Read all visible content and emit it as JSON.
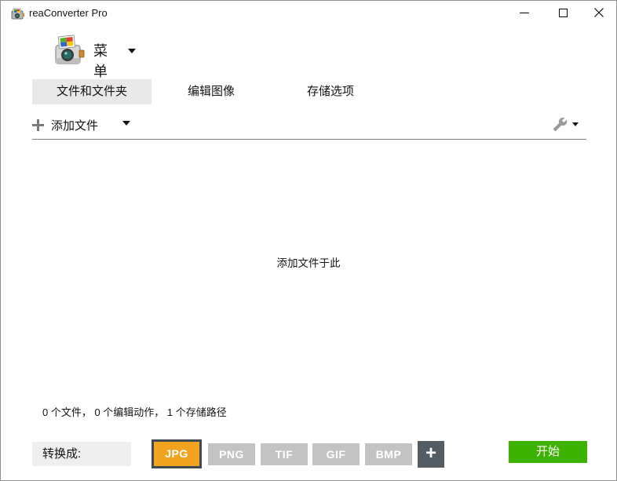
{
  "window": {
    "title": "reaConverter Pro"
  },
  "menu": {
    "label": "菜单"
  },
  "tabs": [
    {
      "label": "文件和文件夹",
      "active": true
    },
    {
      "label": "编辑图像",
      "active": false
    },
    {
      "label": "存储选项",
      "active": false
    }
  ],
  "toolbar": {
    "add_files_label": "添加文件"
  },
  "dropzone": {
    "hint": "添加文件于此"
  },
  "status": {
    "text": "0 个文件，  0 个编辑动作，  1 个存储路径"
  },
  "bottom": {
    "convert_label": "转换成:",
    "formats": [
      {
        "label": "JPG",
        "selected": true
      },
      {
        "label": "PNG",
        "selected": false
      },
      {
        "label": "TIF",
        "selected": false
      },
      {
        "label": "GIF",
        "selected": false
      },
      {
        "label": "BMP",
        "selected": false
      }
    ],
    "add_format_label": "+",
    "start_label": "开始"
  },
  "icons": {
    "app_icon": "camera-logo",
    "menu_logo": "camera-logo-large",
    "menu_dropdown": "chevron-down",
    "add_files": "plus",
    "add_files_dropdown": "chevron-down",
    "settings": "wrench",
    "settings_dropdown": "chevron-down",
    "minimize": "minus",
    "maximize": "square",
    "close": "x"
  },
  "colors": {
    "selected_format_bg": "#f1a21f",
    "selected_format_border": "#3e4952",
    "format_bg": "#c3c3c3",
    "add_format_bg": "#555d64",
    "start_bg": "#3db200",
    "tab_active_bg": "#e9e9e9",
    "convert_label_bg": "#efefef"
  }
}
